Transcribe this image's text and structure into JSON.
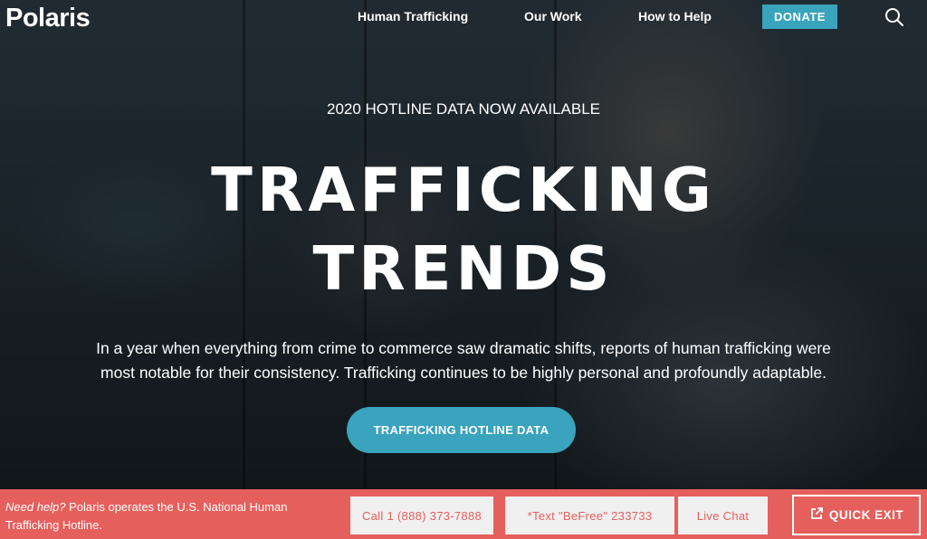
{
  "header": {
    "logo": "Polaris",
    "nav": [
      {
        "label": "Human Trafficking"
      },
      {
        "label": "Our Work"
      },
      {
        "label": "How to Help"
      }
    ],
    "donate_label": "DONATE",
    "search_icon": "search-icon"
  },
  "hero": {
    "eyebrow": "2020 HOTLINE DATA NOW AVAILABLE",
    "headline_line1": "TRAFFICKING",
    "headline_line2": "TRENDS",
    "lede": "In a year when everything from crime to commerce saw dramatic shifts, reports of human trafficking were most notable for their consistency. Trafficking continues to be highly personal and profoundly adaptable.",
    "cta_label": "TRAFFICKING HOTLINE DATA"
  },
  "helpbar": {
    "need_help": "Need help?",
    "help_text": " Polaris operates the U.S. National Human Trafficking Hotline.",
    "call_label": "Call 1 (888) 373-7888",
    "text_label": "*Text \"BeFree\" 233733",
    "chat_label": "Live Chat",
    "quick_exit_label": "QUICK EXIT",
    "quick_exit_icon": "external-link-icon"
  },
  "colors": {
    "accent": "#3aa3bd",
    "helpbar": "#e5605d",
    "white": "#ffffff"
  }
}
